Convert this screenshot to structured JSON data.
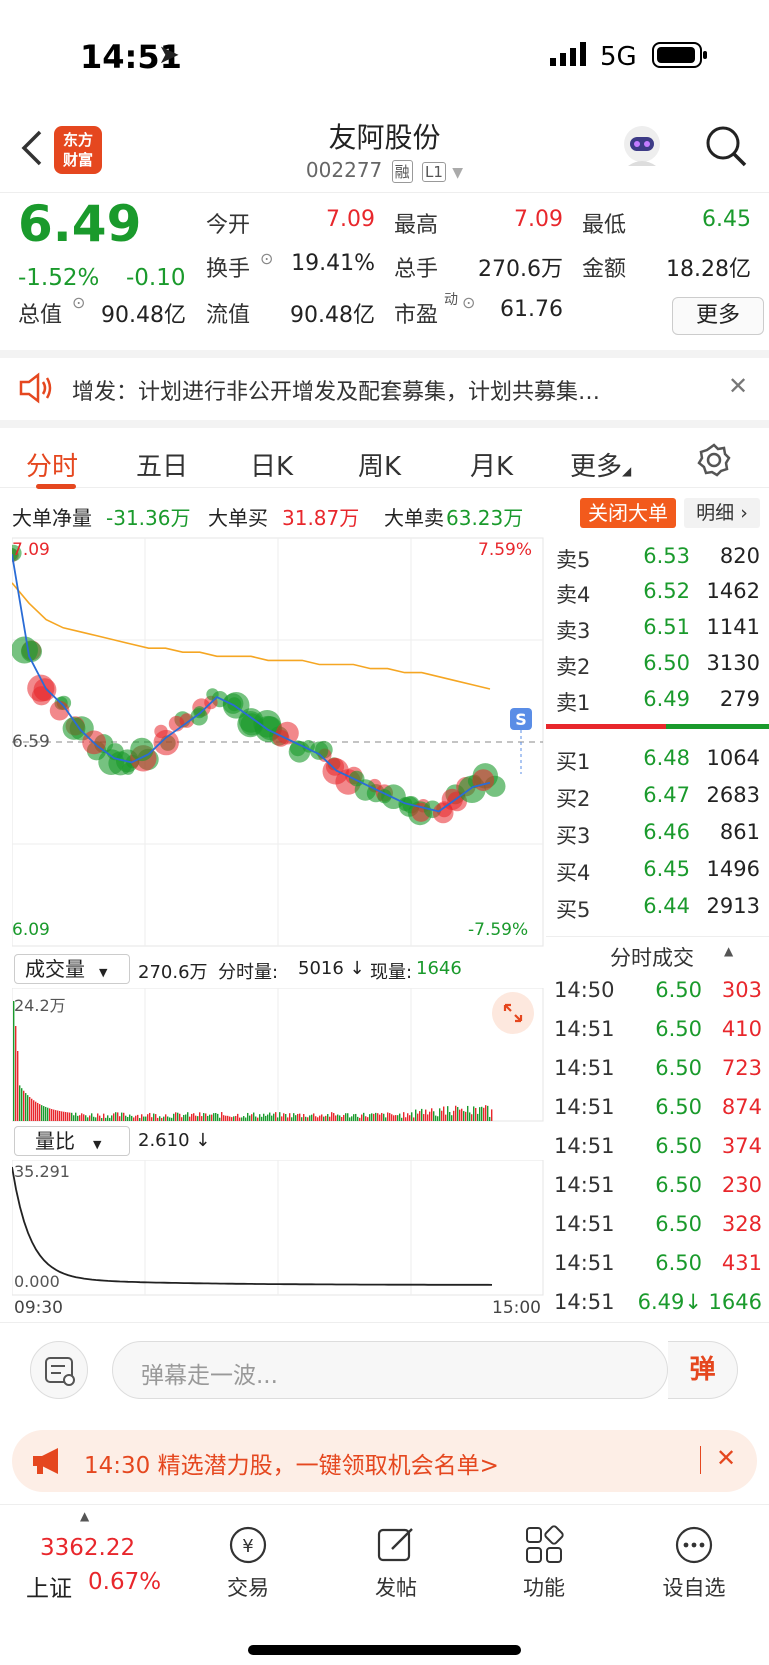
{
  "status": {
    "time": "14:51",
    "network": "5G"
  },
  "header": {
    "logo_line1": "东方",
    "logo_line2": "财富",
    "name": "友阿股份",
    "code": "002277",
    "tag1": "融",
    "tag2": "L1"
  },
  "quote": {
    "price": "6.49",
    "pct": "-1.52%",
    "change": "-0.10",
    "open_label": "今开",
    "open": "7.09",
    "high_label": "最高",
    "high": "7.09",
    "low_label": "最低",
    "low": "6.45",
    "turnover_label": "换手",
    "turnover": "19.41%",
    "vol_label": "总手",
    "vol": "270.6万",
    "amount_label": "金额",
    "amount": "18.28亿",
    "mcap_label": "总值",
    "mcap": "90.48亿",
    "float_label": "流值",
    "float": "90.48亿",
    "pe_label": "市盈",
    "pe_sup": "动",
    "pe": "61.76",
    "more": "更多"
  },
  "notice": {
    "text": "增发：计划进行非公开增发及配套募集，计划共募集…"
  },
  "tabs": [
    "分时",
    "五日",
    "日K",
    "周K",
    "月K",
    "更多"
  ],
  "orders": {
    "net_label": "大单净量",
    "net": "-31.36万",
    "buy_label": "大单买",
    "buy": "31.87万",
    "sell_label": "大单卖",
    "sell": "63.23万",
    "close_btn": "关闭大单",
    "detail_btn": "明细"
  },
  "chart_labels": {
    "top_left": "7.09",
    "top_right": "7.59%",
    "mid": "6.59",
    "bottom_left": "6.09",
    "bottom_right": "-7.59%",
    "marker": "S"
  },
  "chart_data": {
    "type": "line",
    "title": "",
    "ylim": [
      6.09,
      7.09
    ],
    "series": [
      {
        "values": [
          7.05,
          6.8,
          6.72,
          6.68,
          6.62,
          6.58,
          6.55,
          6.54,
          6.56,
          6.6,
          6.63,
          6.66,
          6.7,
          6.68,
          6.65,
          6.62,
          6.6,
          6.58,
          6.56,
          6.52,
          6.5,
          6.48,
          6.46,
          6.44,
          6.43,
          6.42,
          6.45,
          6.48,
          6.49
        ]
      },
      {
        "values": [
          6.98,
          6.93,
          6.89,
          6.87,
          6.86,
          6.85,
          6.84,
          6.83,
          6.82,
          6.82,
          6.81,
          6.81,
          6.8,
          6.8,
          6.8,
          6.79,
          6.79,
          6.79,
          6.78,
          6.78,
          6.78,
          6.77,
          6.77,
          6.76,
          6.76,
          6.75,
          6.74,
          6.73,
          6.72
        ]
      }
    ]
  },
  "book": {
    "asks": [
      {
        "label": "卖5",
        "price": "6.53",
        "vol": "820"
      },
      {
        "label": "卖4",
        "price": "6.52",
        "vol": "1462"
      },
      {
        "label": "卖3",
        "price": "6.51",
        "vol": "1141"
      },
      {
        "label": "卖2",
        "price": "6.50",
        "vol": "3130"
      },
      {
        "label": "卖1",
        "price": "6.49",
        "vol": "279"
      }
    ],
    "bids": [
      {
        "label": "买1",
        "price": "6.48",
        "vol": "1064"
      },
      {
        "label": "买2",
        "price": "6.47",
        "vol": "2683"
      },
      {
        "label": "买3",
        "price": "6.46",
        "vol": "861"
      },
      {
        "label": "买4",
        "price": "6.45",
        "vol": "1496"
      },
      {
        "label": "买5",
        "price": "6.44",
        "vol": "2913"
      }
    ]
  },
  "trades_title": "分时成交",
  "trades": [
    {
      "time": "14:50",
      "price": "6.50",
      "vol": "303"
    },
    {
      "time": "14:51",
      "price": "6.50",
      "vol": "410"
    },
    {
      "time": "14:51",
      "price": "6.50",
      "vol": "723"
    },
    {
      "time": "14:51",
      "price": "6.50",
      "vol": "874"
    },
    {
      "time": "14:51",
      "price": "6.50",
      "vol": "374"
    },
    {
      "time": "14:51",
      "price": "6.50",
      "vol": "230"
    },
    {
      "time": "14:51",
      "price": "6.50",
      "vol": "328"
    },
    {
      "time": "14:51",
      "price": "6.50",
      "vol": "431"
    },
    {
      "time": "14:51",
      "price": "6.49↓",
      "vol": "1646"
    }
  ],
  "volume": {
    "selector": "成交量",
    "total": "270.6万",
    "fen_label": "分时量:",
    "fen": "5016 ↓",
    "now_label": "现量:",
    "now": "1646",
    "max": "24.2万"
  },
  "ratio": {
    "selector": "量比",
    "value": "2.610 ↓",
    "max": "35.291",
    "min": "0.000",
    "start": "09:30",
    "end": "15:00"
  },
  "comment": {
    "placeholder": "弹幕走一波...",
    "send": "弹"
  },
  "promo": {
    "text": "14:30 精选潜力股，一键领取机会名单>"
  },
  "nav": {
    "index_value": "3362.22",
    "index_name": "上证",
    "index_pct": "0.67%",
    "trade": "交易",
    "post": "发帖",
    "func": "功能",
    "watch": "设自选"
  },
  "colors": {
    "up": "#e8272c",
    "down": "#1a9a2c",
    "accent": "#e5471f",
    "avg_line": "#f5a623"
  }
}
